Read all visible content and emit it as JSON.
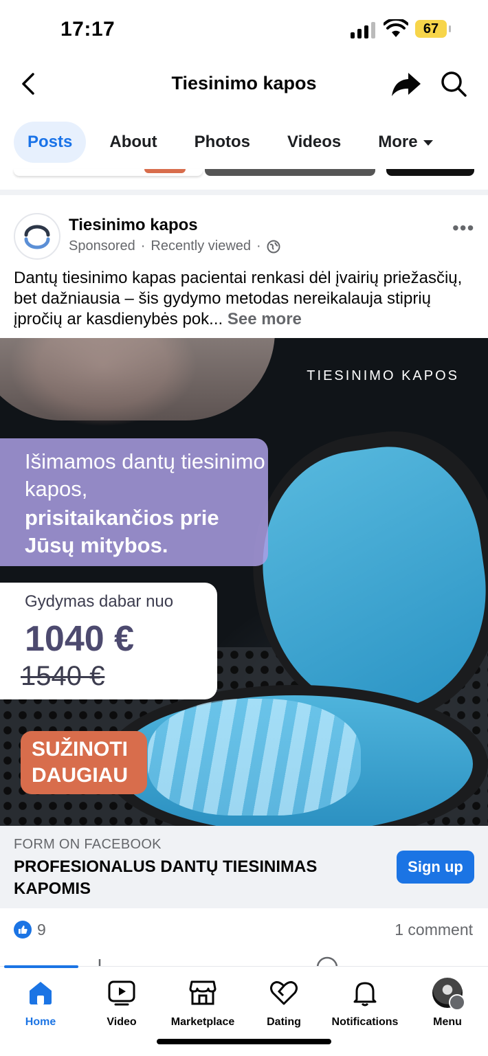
{
  "status_bar": {
    "time": "17:17",
    "battery": "67"
  },
  "header": {
    "title": "Tiesinimo kapos"
  },
  "tabs": [
    {
      "label": "Posts"
    },
    {
      "label": "About"
    },
    {
      "label": "Photos"
    },
    {
      "label": "Videos"
    },
    {
      "label": "More"
    }
  ],
  "post": {
    "author": "Tiesinimo kapos",
    "meta_sponsored": "Sponsored",
    "meta_viewed": "Recently viewed",
    "text": "Dantų tiesinimo kapas pacientai renkasi dėl įvairių priežasčių, bet dažniausia – šis gydymo metodas nereikalauja stiprių įpročių ar kasdienybės pok...",
    "see_more": "See more",
    "ad": {
      "brand": "TIESINIMO KAPOS",
      "headline_1": "Išimamos dantų tiesinimo kapos,",
      "headline_2": "prisitaikančios prie Jūsų mitybos.",
      "price_from": "Gydymas dabar nuo",
      "price_now": "1040 €",
      "price_old": "1540 €",
      "cta": "SUŽINOTI DAUGIAU"
    },
    "form": {
      "kicker": "FORM ON FACEBOOK",
      "title": "PROFESIONALUS DANTŲ TIESINIMAS KAPOMIS",
      "button": "Sign up"
    },
    "likes": "9",
    "comments": "1 comment"
  },
  "bottom_nav": [
    {
      "label": "Home",
      "icon": "home-icon"
    },
    {
      "label": "Video",
      "icon": "video-icon"
    },
    {
      "label": "Marketplace",
      "icon": "marketplace-icon"
    },
    {
      "label": "Dating",
      "icon": "dating-icon"
    },
    {
      "label": "Notifications",
      "icon": "bell-icon"
    },
    {
      "label": "Menu",
      "icon": "profile-avatar"
    }
  ],
  "colors": {
    "accent": "#1b74e4",
    "tab_active_bg": "#e7f0fd",
    "cta": "#d86d4c",
    "ad_purple": "#aa9ee4"
  }
}
